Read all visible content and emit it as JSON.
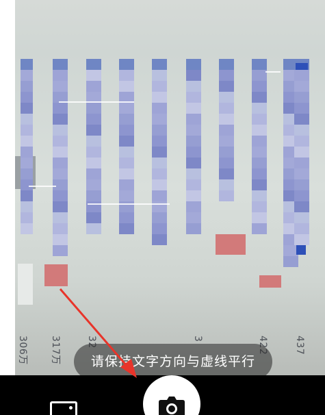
{
  "hint": {
    "text": "请保持文字方向与虚线平行"
  },
  "bottom_numbers": [
    "306万",
    "317万",
    "32",
    "3",
    "422",
    "437"
  ],
  "controls": {
    "gallery_icon": "image-gallery-icon",
    "shutter_icon": "camera-icon"
  },
  "colors": {
    "hint_bg": "rgba(40,40,40,0.55)",
    "annotation_arrow": "#e8342a",
    "bottom_bar": "#000000"
  }
}
